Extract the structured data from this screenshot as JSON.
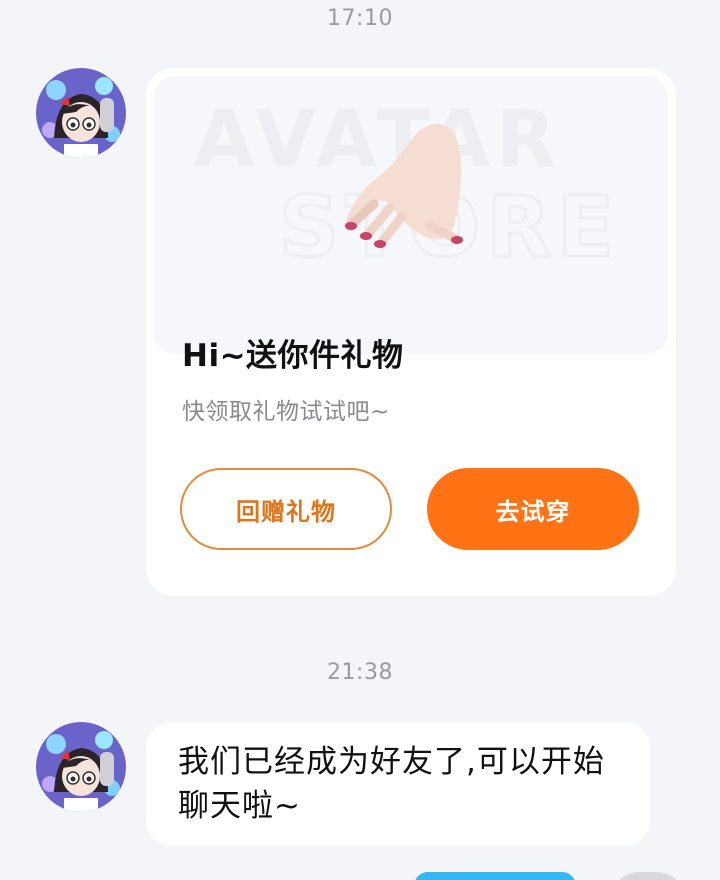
{
  "chat": {
    "timestamps": [
      "17:10",
      "21:38"
    ],
    "gift_card": {
      "banner_text": "AVATAR STORE",
      "title": "Hi~送你件礼物",
      "subtitle": "快领取礼物试试吧~",
      "return_gift_label": "回赠礼物",
      "try_on_label": "去试穿"
    },
    "messages": [
      {
        "text": "我们已经成为好友了,可以开始聊天啦~"
      }
    ]
  },
  "colors": {
    "accent_orange": "#ff7314",
    "outline_orange": "#e38a3c",
    "background": "#f4f5f8",
    "sent_bubble_blue": "#32b8f5"
  }
}
